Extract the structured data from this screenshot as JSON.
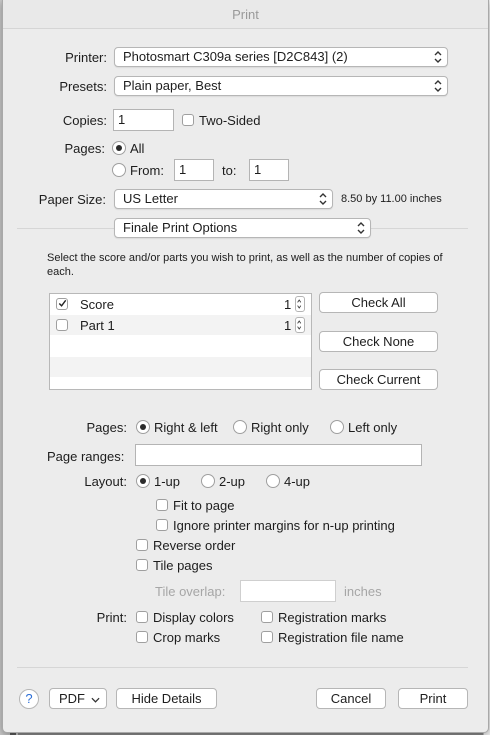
{
  "window": {
    "title": "Print"
  },
  "printer": {
    "label": "Printer:",
    "value": "Photosmart C309a series [D2C843] (2)"
  },
  "presets": {
    "label": "Presets:",
    "value": "Plain paper, Best"
  },
  "copies": {
    "label": "Copies:",
    "value": "1",
    "two_sided_label": "Two-Sided"
  },
  "pages": {
    "label": "Pages:",
    "all_label": "All",
    "from_label": "From:",
    "from_value": "1",
    "to_label": "to:",
    "to_value": "1"
  },
  "paper": {
    "label": "Paper Size:",
    "value": "US Letter",
    "dimensions": "8.50 by 11.00 inches"
  },
  "panel": {
    "value": "Finale Print Options"
  },
  "finale": {
    "instructions": "Select the score and/or parts you wish to print, as well as the number of copies of each.",
    "items": [
      {
        "name": "Score",
        "copies": "1",
        "checked": true
      },
      {
        "name": "Part 1",
        "copies": "1",
        "checked": false
      }
    ],
    "check_all": "Check All",
    "check_none": "Check None",
    "check_current": "Check Current",
    "pages_label": "Pages:",
    "pages_options": [
      "Right & left",
      "Right only",
      "Left only"
    ],
    "page_ranges_label": "Page ranges:",
    "page_ranges_value": "",
    "layout_label": "Layout:",
    "layout_options": [
      "1-up",
      "2-up",
      "4-up"
    ],
    "fit_to_page": "Fit to page",
    "ignore_margins": "Ignore printer margins for n-up printing",
    "reverse_order": "Reverse order",
    "tile_pages": "Tile pages",
    "tile_overlap_label": "Tile overlap:",
    "tile_overlap_value": "",
    "tile_overlap_unit": "inches",
    "print_label": "Print:",
    "display_colors": "Display colors",
    "registration_marks": "Registration marks",
    "crop_marks": "Crop marks",
    "registration_file_name": "Registration file name"
  },
  "footer": {
    "help": "?",
    "pdf": "PDF",
    "hide_details": "Hide Details",
    "cancel": "Cancel",
    "print": "Print"
  }
}
